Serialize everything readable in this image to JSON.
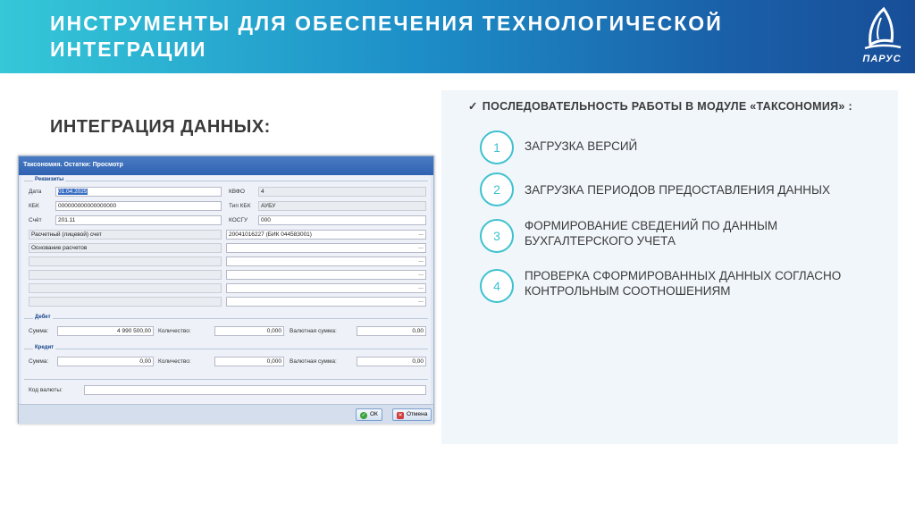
{
  "header": {
    "title": "ИНСТРУМЕНТЫ ДЛЯ ОБЕСПЕЧЕНИЯ ТЕХНОЛОГИЧЕСКОЙ ИНТЕГРАЦИИ",
    "logo_text": "ПАРУС"
  },
  "subtitle": "ИНТЕГРАЦИЯ ДАННЫХ:",
  "window": {
    "title": "Таксономия. Остатки: Просмотр",
    "requisites_legend": "Реквизиты",
    "date_label": "Дата",
    "date_value": "01.04.2025",
    "kvfo_label": "КВФО",
    "kvfo_value": "4",
    "kbk_label": "КБК",
    "kbk_value": "000000000000000000",
    "tip_kbk_label": "Тип КБК",
    "tip_kbk_value": "АУБУ",
    "schet_label": "Счёт",
    "schet_value": "201.11",
    "kosgu_label": "КОСГУ",
    "kosgu_value": "000",
    "account_label": "Расчетный (лицевой) счет",
    "account_value": "20041016227 (БИК 044583001)",
    "basis_label": "Основание расчетов",
    "debit_legend": "Дебет",
    "credit_legend": "Кредит",
    "sum_label": "Сумма:",
    "qty_label": "Количество:",
    "cur_sum_label": "Валютная сумма:",
    "debit_sum": "4 990 500,00",
    "debit_qty": "0,000",
    "debit_cur": "0,00",
    "credit_sum": "0,00",
    "credit_qty": "0,000",
    "credit_cur": "0,00",
    "currency_code_label": "Код валюты:",
    "ok_label": "ОК",
    "cancel_label": "Отмена",
    "dots": "..."
  },
  "panel": {
    "heading": "ПОСЛЕДОВАТЕЛЬНОСТЬ РАБОТЫ В МОДУЛЕ «ТАКСОНОМИЯ» :",
    "check": "✓",
    "steps": [
      {
        "num": "1",
        "text": "ЗАГРУЗКА ВЕРСИЙ"
      },
      {
        "num": "2",
        "text": "ЗАГРУЗКА ПЕРИОДОВ ПРЕДОСТАВЛЕНИЯ ДАННЫХ"
      },
      {
        "num": "3",
        "text": "ФОРМИРОВАНИЕ СВЕДЕНИЙ ПО ДАННЫМ БУХГАЛТЕРСКОГО УЧЕТА"
      },
      {
        "num": "4",
        "text": "ПРОВЕРКА СФОРМИРОВАННЫХ ДАННЫХ СОГЛАСНО КОНТРОЛЬНЫМ СООТНОШЕНИЯМ"
      }
    ]
  },
  "colors": {
    "header_start": "#35c8d8",
    "header_end": "#184e98",
    "accent": "#3dc1d0",
    "panel_bg": "#f1f6fa"
  }
}
